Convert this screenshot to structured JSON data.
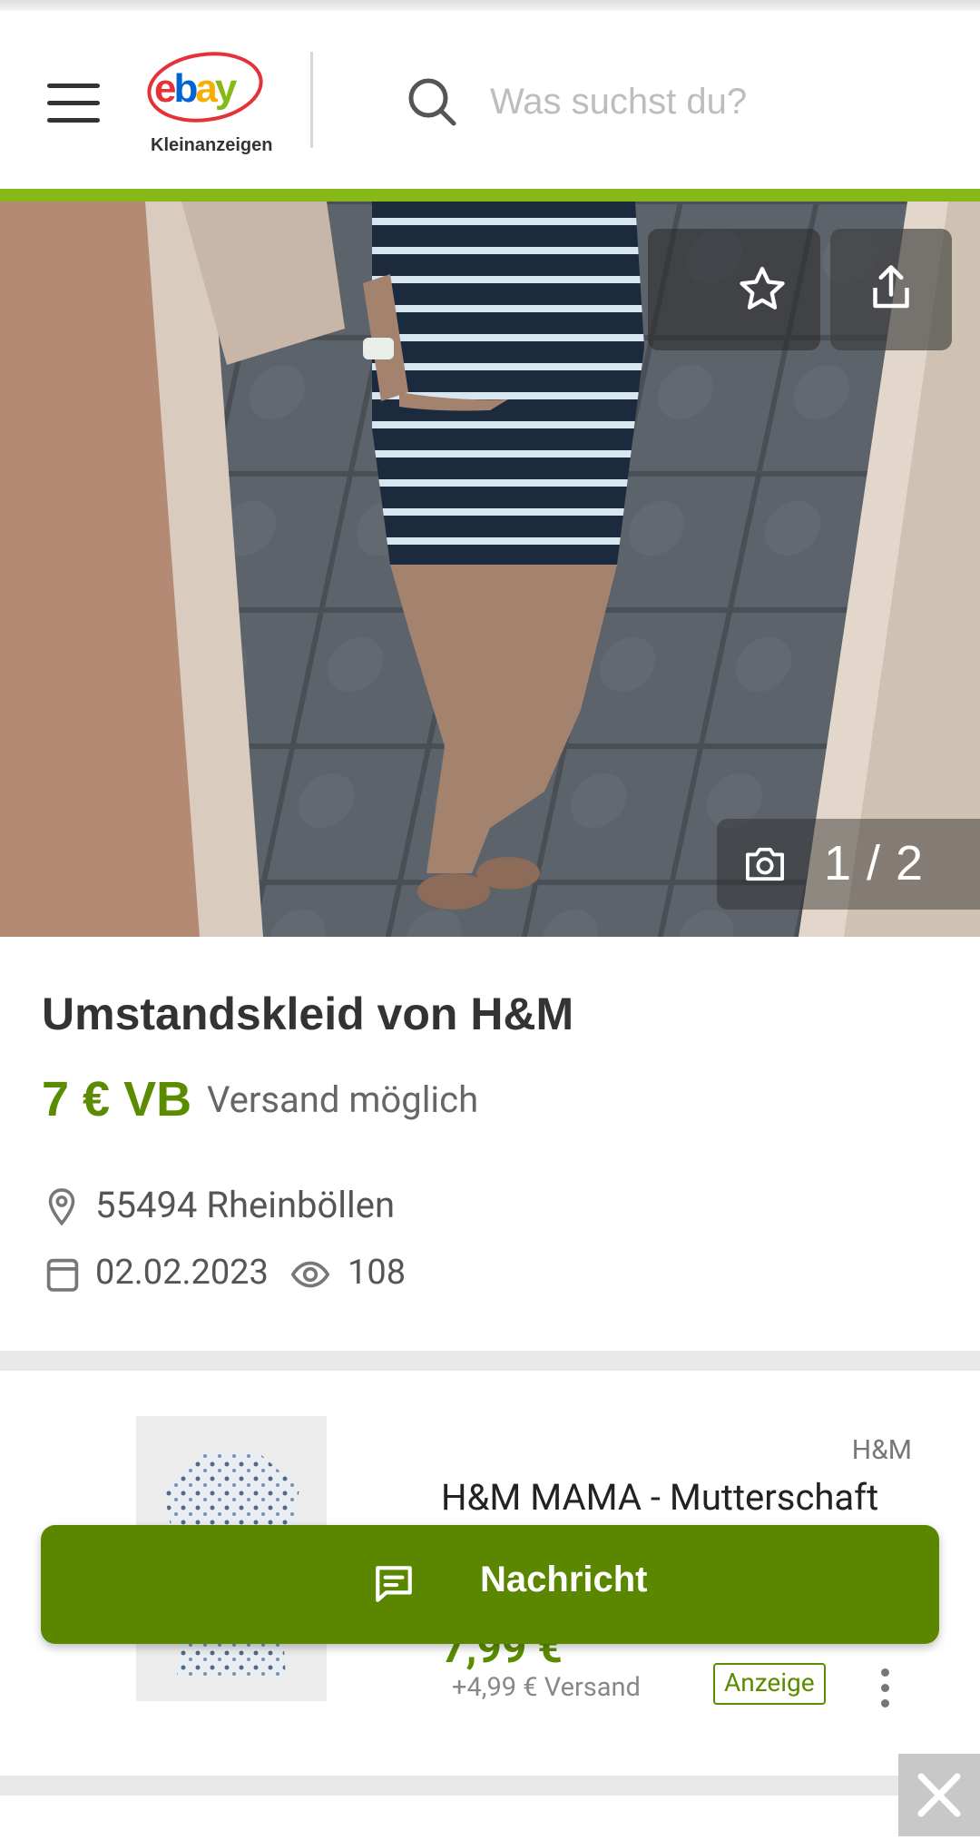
{
  "header": {
    "logo_line1": "ebay",
    "logo_line2": "Kleinanzeigen",
    "search_placeholder": "Was suchst du?",
    "accent_color": "#86b817"
  },
  "gallery": {
    "counter": "1 / 2",
    "favorite_icon": "star-icon",
    "share_icon": "share-icon",
    "camera_icon": "camera-icon"
  },
  "listing": {
    "title": "Umstandskleid von H&M",
    "price": "7 € VB",
    "shipping": "Versand möglich",
    "location": "55494 Rheinböllen",
    "date": "02.02.2023",
    "views": "108",
    "price_color": "#5b8c00"
  },
  "ad": {
    "brand": "H&M",
    "title": "H&M MAMA - Mutterschaft",
    "price": "7,99 €",
    "shipping": "+4,99 € Versand",
    "badge": "Anzeige"
  },
  "message_button": {
    "label": "Nachricht",
    "icon": "chat-icon",
    "color": "#5b8700"
  },
  "close_icon": "close-icon"
}
